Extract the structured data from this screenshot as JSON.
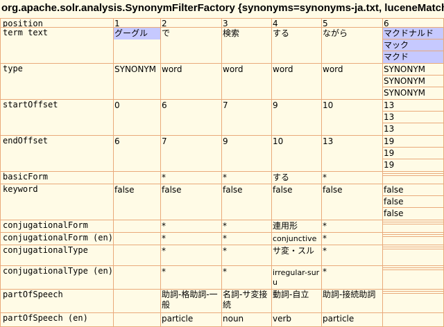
{
  "title": "org.apache.solr.analysis.SynonymFilterFactory {synonyms=synonyms-ja.txt, luceneMatchVe",
  "labels": {
    "position": "position",
    "term_text": "term text",
    "type": "type",
    "startOffset": "startOffset",
    "endOffset": "endOffset",
    "basicForm": "basicForm",
    "keyword": "keyword",
    "conjugationalForm": "conjugationalForm",
    "conjugationalForm_en": "conjugationalForm (en)",
    "conjugationalType": "conjugationalType",
    "conjugationalType_en": "conjugationalType (en)",
    "partOfSpeech": "partOfSpeech",
    "partOfSpeech_en": "partOfSpeech (en)"
  },
  "columns": [
    {
      "position": "1",
      "term": [
        "グーグル"
      ],
      "type": [
        "SYNONYM"
      ],
      "start": [
        "0"
      ],
      "end": [
        "6"
      ],
      "basicForm": "",
      "keyword": [
        "false"
      ],
      "conjForm": "",
      "conjFormEn": "",
      "conjType": "",
      "conjTypeEn": "",
      "pos": "",
      "posEn": ""
    },
    {
      "position": "2",
      "term": [
        "で"
      ],
      "type": [
        "word"
      ],
      "start": [
        "6"
      ],
      "end": [
        "7"
      ],
      "basicForm": "*",
      "keyword": [
        "false"
      ],
      "conjForm": "*",
      "conjFormEn": "*",
      "conjType": "*",
      "conjTypeEn": "*",
      "pos": "助詞-格助詞-一般",
      "posEn": "particle"
    },
    {
      "position": "3",
      "term": [
        "検索"
      ],
      "type": [
        "word"
      ],
      "start": [
        "7"
      ],
      "end": [
        "9"
      ],
      "basicForm": "*",
      "keyword": [
        "false"
      ],
      "conjForm": "*",
      "conjFormEn": "*",
      "conjType": "*",
      "conjTypeEn": "*",
      "pos": "名詞-サ変接続",
      "posEn": "noun"
    },
    {
      "position": "4",
      "term": [
        "する"
      ],
      "type": [
        "word"
      ],
      "start": [
        "9"
      ],
      "end": [
        "10"
      ],
      "basicForm": "する",
      "keyword": [
        "false"
      ],
      "conjForm": "連用形",
      "conjFormEn": "conjunctive",
      "conjType": "サ変・スル",
      "conjTypeEn": "irregular-suru",
      "pos": "動詞-自立",
      "posEn": "verb"
    },
    {
      "position": "5",
      "term": [
        "ながら"
      ],
      "type": [
        "word"
      ],
      "start": [
        "10"
      ],
      "end": [
        "13"
      ],
      "basicForm": "*",
      "keyword": [
        "false"
      ],
      "conjForm": "*",
      "conjFormEn": "*",
      "conjType": "*",
      "conjTypeEn": "*",
      "pos": "助詞-接続助詞",
      "posEn": "particle"
    },
    {
      "position": "6",
      "term": [
        "マクドナルド",
        "マック",
        "マクド"
      ],
      "type": [
        "SYNONYM",
        "SYNONYM",
        "SYNONYM"
      ],
      "start": [
        "13",
        "13",
        "13"
      ],
      "end": [
        "19",
        "19",
        "19"
      ],
      "basicForm": "",
      "keyword": [
        "false",
        "false",
        "false"
      ],
      "conjForm": "",
      "conjFormEn": "",
      "conjType": "",
      "conjTypeEn": "",
      "pos": "",
      "posEn": ""
    }
  ],
  "colors": {
    "background": "#fffbe6",
    "border": "#e9a97a",
    "highlight": "#c6c9ff"
  }
}
